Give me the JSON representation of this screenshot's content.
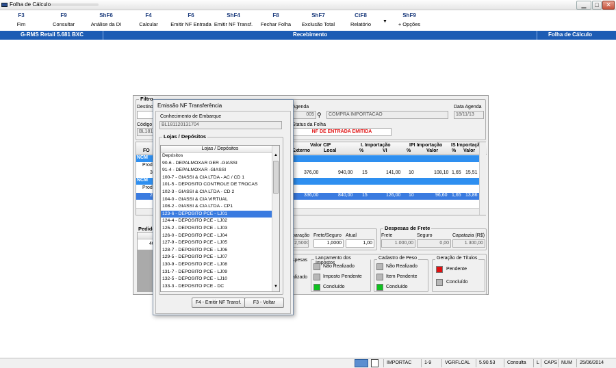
{
  "window": {
    "title": "Folha de Cálculo"
  },
  "toolbar": [
    {
      "key": "F3",
      "label": "Fim"
    },
    {
      "key": "F9",
      "label": "Consultar"
    },
    {
      "key": "ShF6",
      "label": "Análise da DI"
    },
    {
      "key": "F4",
      "label": "Calcular"
    },
    {
      "key": "F6",
      "label": "Emitir NF Entrada"
    },
    {
      "key": "ShF4",
      "label": "Emitir NF Transf."
    },
    {
      "key": "F8",
      "label": "Fechar Folha"
    },
    {
      "key": "ShF7",
      "label": "Exclusão Total"
    },
    {
      "key": "CtF8",
      "label": "Relatório"
    },
    {
      "key": "ShF9",
      "label": "+ Opções"
    }
  ],
  "header": {
    "app": "G-RMS Retail 5.681 BXC",
    "module": "Recebimento",
    "screen": "Folha de Cálculo"
  },
  "form": {
    "filtro": "Filtro",
    "destino": "Destino",
    "agenda_label": "Agenda",
    "agenda_code": "005",
    "agenda_desc": "COMPRA IMPORTACAO",
    "data_agenda_label": "Data Agenda",
    "data_agenda": "18/11/13",
    "codigo_label": "Código d",
    "codigo_value": "BL181",
    "status_label": "Status da Folha",
    "status_value": "NF DE ENTRADA EMITIDA",
    "grid_headers": {
      "fo": "FO",
      "valor_cif": "Valor CIF",
      "externo": "Externo",
      "local": "Local",
      "i_imp": "I. Importação",
      "pct": "%",
      "vi": "VI",
      "ipi_imp": "IPI Importação",
      "valor": "Valor",
      "is_imp": "IS Importaçã",
      "valor2": "Valor"
    },
    "grid_left": [
      "NCM",
      "Produ",
      "3",
      "NCM",
      "Produ",
      "2"
    ],
    "rows": [
      {
        "externo": "376,00",
        "local": "940,00",
        "ipct": "15",
        "vi": "141,00",
        "ipipct": "10",
        "ipival": "108,10",
        "ispct": "1,65",
        "isval": "15,51"
      },
      {
        "externo": "336,00",
        "local": "840,00",
        "ipct": "15",
        "vi": "126,00",
        "ipipct": "10",
        "ipival": "96,60",
        "ispct": "1,65",
        "isval": "13,86"
      }
    ],
    "pedido_label": "Pedido",
    "pedido_value": "40",
    "despesas_frete_title": "Despesas de Frete",
    "processo_title": "sso",
    "paracao_label": "paração",
    "paracao_value": "2,5000",
    "frete_seguro_label": "Frete/Seguro",
    "frete_seguro_value": "1,0000",
    "atual_label": "Atual",
    "atual_value": "1,00",
    "frete_label": "Frete",
    "frete_value": "1.000,00",
    "seguro_label": "Seguro",
    "seguro_value": "0,00",
    "capatazia_label": "Capatazia (R$)",
    "capatazia_value": "1.300,00",
    "etapas_title": "ha",
    "despesas_partial": "spesas",
    "realizado_partial": "alizado",
    "lanc_title": "Lançamento dos Impostos",
    "cad_title": "Cadastro de Peso",
    "ger_title": "Geração de Títulos",
    "nao_realizado": "Não Realizado",
    "imposto_pendente": "Imposto Pendente",
    "item_pendente": "Item Pendente",
    "concluido": "Concluído",
    "pendente": "Pendente"
  },
  "modal": {
    "title": "Emissão NF Transferência",
    "conhecimento_label": "Conhecimento de Embarque",
    "conhecimento_value": "BL181120131704",
    "lojas_title": "Lojas / Depósitos",
    "list_header": "Lojas / Depósitos",
    "items": [
      "Depósitos",
      "90-6 - DEPALMOXAR GER -GIASSI",
      "91-4 - DEPALMOXAR -GIASSI",
      "100-7 - GIASSI & CIA LTDA - AC / CD 1",
      "101-5 - DEPOSITO CONTROLE DE TROCAS",
      "102-3 - GIASSI & CIA LTDA - CD 2",
      "104-0 - GIASSI & CIA VIRTUAL",
      "108-2 - GIASSI & CIA LTDA - CP1",
      "123-6 - DEPOSITO PCE - LJ01",
      "124-4 - DEPOSITO PCE - LJ02",
      "125-2 - DEPOSITO PCE - LJ03",
      "126-0 - DEPOSITO PCE - LJ04",
      "127-9 - DEPOSITO PCE - LJ05",
      "128-7 - DEPOSITO PCE - LJ06",
      "129-5 - DEPOSITO PCE - LJ07",
      "130-9 - DEPOSITO PCE - LJ08",
      "131-7 - DEPOSITO PCE - LJ09",
      "132-5 - DEPOSITO PCE - LJ10",
      "133-3 - DEPOSITO PCE - DC"
    ],
    "selected_index": 8,
    "btn_emitir": "F4 - Emitir NF Transf.",
    "btn_voltar": "F3 - Voltar"
  },
  "status": {
    "user": "IMPORTAC",
    "page": "1-9",
    "program": "VGRFLCAL",
    "version": "5.90.53",
    "mode": "Consulta",
    "l": "L",
    "caps": "CAPS",
    "num": "NUM",
    "date": "25/06/2014"
  },
  "colors": {
    "header_blue": "#1c5cb4",
    "selection": "#3a7be0",
    "pendente": "#e01010",
    "concluido": "#10c020",
    "status_red": "#e01010"
  }
}
